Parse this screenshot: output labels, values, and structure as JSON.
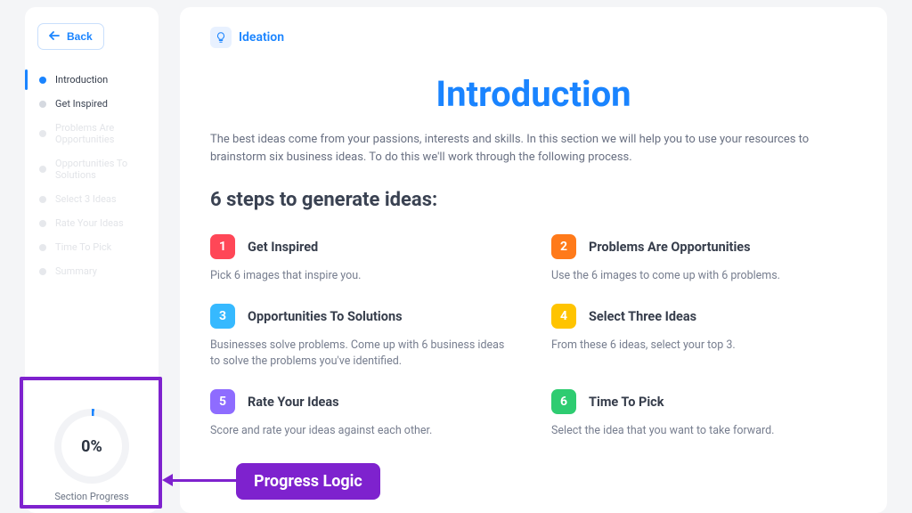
{
  "sidebar": {
    "back_label": "Back",
    "items": [
      {
        "label": "Introduction",
        "state": "active"
      },
      {
        "label": "Get Inspired",
        "state": "unlocked"
      },
      {
        "label": "Problems Are Opportunities",
        "state": "locked"
      },
      {
        "label": "Opportunities To Solutions",
        "state": "locked"
      },
      {
        "label": "Select 3 Ideas",
        "state": "locked"
      },
      {
        "label": "Rate Your Ideas",
        "state": "locked"
      },
      {
        "label": "Time To Pick",
        "state": "locked"
      },
      {
        "label": "Summary",
        "state": "locked"
      }
    ],
    "progress": {
      "value": "0%",
      "label": "Section Progress"
    }
  },
  "breadcrumb": {
    "section": "Ideation"
  },
  "page": {
    "title": "Introduction",
    "intro": "The best ideas come from your passions, interests and skills. In this section we will help you to use your resources to brainstorm six business ideas. To do this we'll work through the following process.",
    "steps_heading": "6 steps to generate ideas:"
  },
  "steps": [
    {
      "n": "1",
      "color": "c-red",
      "title": "Get Inspired",
      "desc": "Pick 6 images that inspire you."
    },
    {
      "n": "2",
      "color": "c-orange",
      "title": "Problems Are Opportunities",
      "desc": "Use the 6 images to come up with 6 problems."
    },
    {
      "n": "3",
      "color": "c-blue",
      "title": "Opportunities To Solutions",
      "desc": "Businesses solve problems. Come up with 6 business ideas to solve the problems you've identified."
    },
    {
      "n": "4",
      "color": "c-yellow",
      "title": "Select Three Ideas",
      "desc": "From these 6 ideas, select your top 3."
    },
    {
      "n": "5",
      "color": "c-purple",
      "title": "Rate Your Ideas",
      "desc": "Score and rate your ideas against each other."
    },
    {
      "n": "6",
      "color": "c-green",
      "title": "Time To Pick",
      "desc": "Select the idea that you want to take forward."
    }
  ],
  "annotation": {
    "callout": "Progress Logic"
  }
}
